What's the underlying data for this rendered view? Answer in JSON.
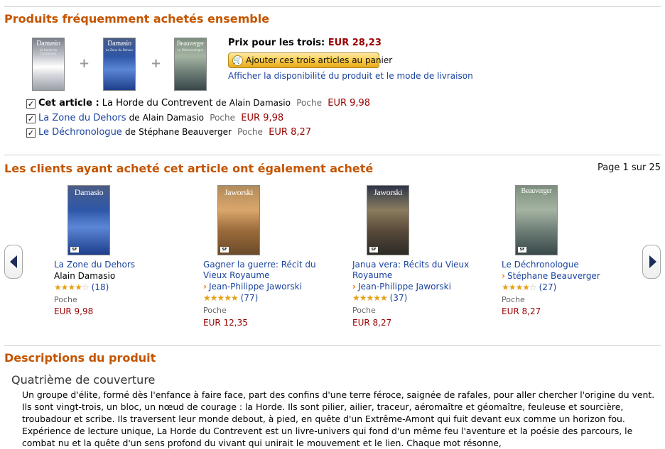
{
  "bundle": {
    "heading": "Produits fréquemment achetés ensemble",
    "price_label": "Prix pour les trois:",
    "price_value": "EUR 28,23",
    "cart_button": "Ajouter ces trois articles au panier",
    "availability_link": "Afficher la disponibilité du produit et le mode de livraison",
    "covers": [
      {
        "author": "Damasio",
        "subtitle": "La Horde du Contrevent"
      },
      {
        "author": "Damasio",
        "subtitle": "La Zone du Dehors"
      },
      {
        "author": "Beauverger",
        "subtitle": "Le Déchronologue"
      }
    ],
    "items": [
      {
        "prefix": "Cet article :",
        "title": "La Horde du Contrevent",
        "by": "de",
        "author": "Alain Damasio",
        "format": "Poche",
        "price": "EUR 9,98",
        "checked": true
      },
      {
        "prefix": "",
        "title": "La Zone du Dehors",
        "by": "de",
        "author": "Alain Damasio",
        "format": "Poche",
        "price": "EUR 9,98",
        "checked": true
      },
      {
        "prefix": "",
        "title": "Le Déchronologue",
        "by": "de",
        "author": "Stéphane Beauverger",
        "format": "Poche",
        "price": "EUR 8,27",
        "checked": true
      }
    ]
  },
  "also_bought": {
    "heading": "Les clients ayant acheté cet article ont également acheté",
    "page_indicator": "Page 1 sur 25",
    "products": [
      {
        "cover_author": "Damasio",
        "title": "La Zone du Dehors",
        "author": "Alain Damasio",
        "author_link": false,
        "rating": 4,
        "reviews": "(18)",
        "format": "Poche",
        "price": "EUR 9,98"
      },
      {
        "cover_author": "Jaworski",
        "title": "Gagner la guerre: Récit du Vieux Royaume",
        "author": "Jean-Philippe Jaworski",
        "author_link": true,
        "rating": 4.5,
        "reviews": "(77)",
        "format": "Poche",
        "price": "EUR 12,35"
      },
      {
        "cover_author": "Jaworski",
        "title": "Janua vera: Récits du Vieux Royaume",
        "author": "Jean-Philippe Jaworski",
        "author_link": true,
        "rating": 4.5,
        "reviews": "(37)",
        "format": "Poche",
        "price": "EUR 8,27"
      },
      {
        "cover_author": "Beauverger",
        "title": "Le Déchronologue",
        "author": "Stéphane Beauverger",
        "author_link": true,
        "rating": 4,
        "reviews": "(27)",
        "format": "Poche",
        "price": "EUR 8,27"
      }
    ]
  },
  "description": {
    "heading": "Descriptions du produit",
    "subheading": "Quatrième de couverture",
    "body": "Un groupe d'élite, formé dès l'enfance à faire face, part des confins d'une terre féroce, saignée de rafales, pour aller chercher l'origine du vent. Ils sont vingt-trois, un bloc, un nœud de courage : la Horde. Ils sont pilier, ailier, traceur, aéromaître et géomaître, feuleuse et sourcière, troubadour et scribe. Ils traversent leur monde debout, à pied, en quête d'un Extrême-Amont qui fuit devant eux comme un horizon fou. Expérience de lecture unique, La Horde du Contrevent est un livre-univers qui fond d'un même feu l'aventure et la poésie des parcours, le combat nu et la quête d'un sens profond du vivant qui unirait le mouvement et le lien. Chaque mot résonne,"
  },
  "colors": {
    "heading": "#c45500",
    "link": "#1a44a0",
    "price": "#990000"
  }
}
